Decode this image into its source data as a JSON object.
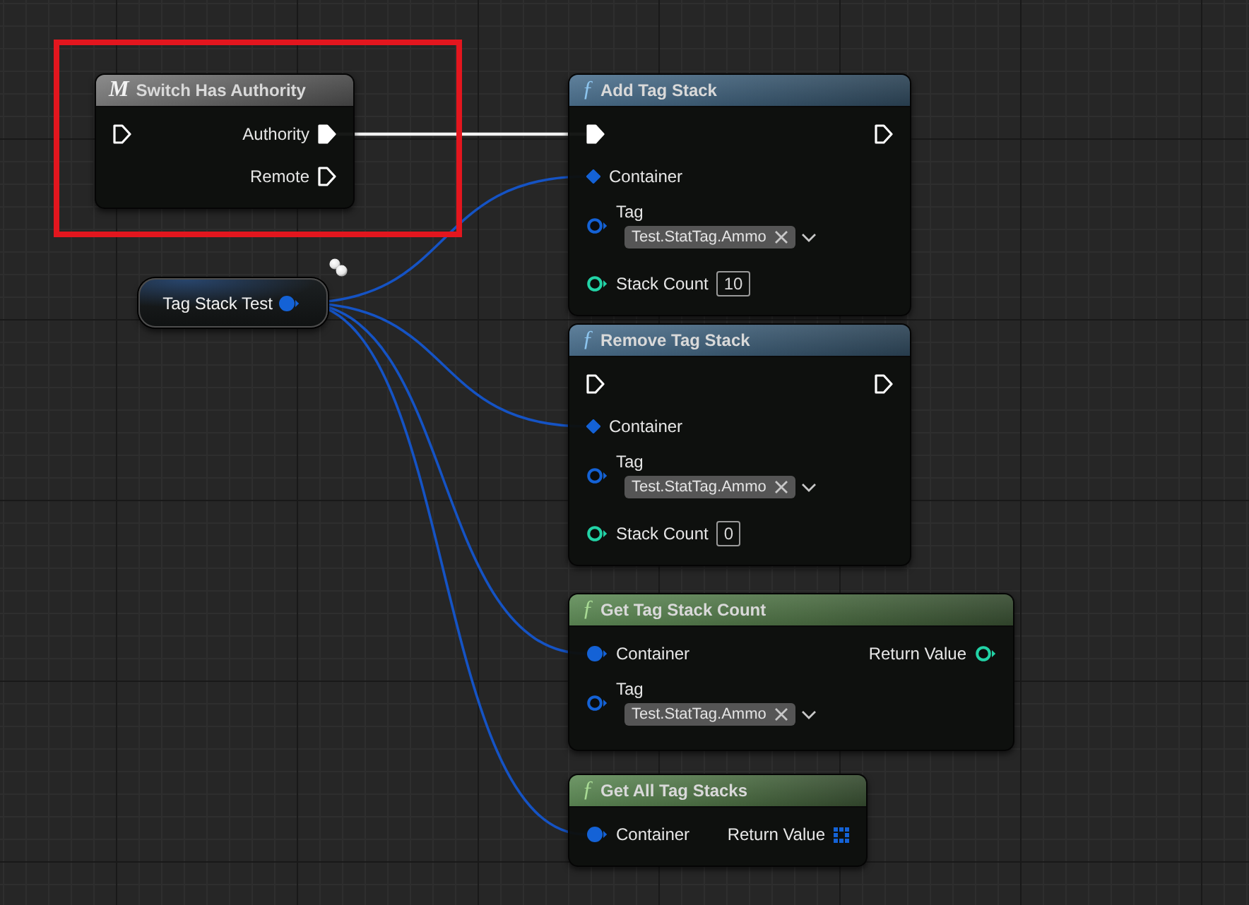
{
  "canvas": {
    "nodes": [
      {
        "kind": "macro",
        "glyph": "M",
        "title": "Switch Has Authority",
        "highlighted": true,
        "rows": [
          {
            "left": {
              "kind": "exec",
              "connected": false
            },
            "right": {
              "kind": "exec",
              "label": "Authority",
              "connected": true
            }
          },
          {
            "right": {
              "kind": "exec",
              "label": "Remote",
              "connected": false
            }
          }
        ]
      },
      {
        "kind": "function",
        "glyph": "ƒ",
        "title": "Add Tag Stack",
        "highlighted": false,
        "rows": [
          {
            "left": {
              "kind": "exec",
              "connected": true
            },
            "right": {
              "kind": "exec",
              "connected": false
            }
          },
          {
            "left": {
              "kind": "ref",
              "label": "Container",
              "connected": true
            }
          },
          {
            "left": {
              "kind": "tag",
              "label": "Tag",
              "connected": false,
              "tag": "Test.StatTag.Ammo"
            }
          },
          {
            "left": {
              "kind": "int",
              "label": "Stack Count",
              "connected": false,
              "value": "10"
            }
          }
        ]
      },
      {
        "kind": "variable",
        "title": "Tag Stack Test",
        "highlighted": false,
        "replicated": true,
        "rows": [
          {
            "right": {
              "kind": "struct",
              "connected": true
            }
          }
        ]
      },
      {
        "kind": "function",
        "glyph": "ƒ",
        "title": "Remove Tag Stack",
        "highlighted": false,
        "rows": [
          {
            "left": {
              "kind": "exec",
              "connected": false
            },
            "right": {
              "kind": "exec",
              "connected": false
            }
          },
          {
            "left": {
              "kind": "ref",
              "label": "Container",
              "connected": true
            }
          },
          {
            "left": {
              "kind": "tag",
              "label": "Tag",
              "connected": false,
              "tag": "Test.StatTag.Ammo"
            }
          },
          {
            "left": {
              "kind": "int",
              "label": "Stack Count",
              "connected": false,
              "value": "0"
            }
          }
        ]
      },
      {
        "kind": "pure",
        "glyph": "ƒ",
        "title": "Get Tag Stack Count",
        "highlighted": false,
        "rows": [
          {
            "left": {
              "kind": "struct",
              "label": "Container",
              "connected": true
            },
            "right": {
              "kind": "int",
              "label": "Return Value",
              "connected": false
            }
          },
          {
            "left": {
              "kind": "tag",
              "label": "Tag",
              "connected": false,
              "tag": "Test.StatTag.Ammo"
            }
          }
        ]
      },
      {
        "kind": "pure",
        "glyph": "ƒ",
        "title": "Get All Tag Stacks",
        "highlighted": false,
        "rows": [
          {
            "left": {
              "kind": "struct",
              "label": "Container",
              "connected": true
            },
            "right": {
              "kind": "map",
              "label": "Return Value",
              "connected": false
            }
          }
        ]
      }
    ]
  }
}
